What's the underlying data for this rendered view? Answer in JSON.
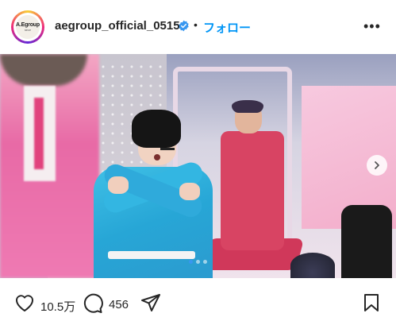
{
  "header": {
    "avatar_logo": "A.Egroup",
    "avatar_sub": "since",
    "username": "aegroup_official_0515",
    "separator": "•",
    "follow_label": "フォロー",
    "more_label": "•••"
  },
  "post": {
    "carousel_dot_count": 3,
    "carousel_active_index": 0
  },
  "actions": {
    "like_count": "10.5万",
    "comment_count": "456"
  },
  "colors": {
    "accent": "#0095f6",
    "text": "#262626",
    "verified": "#3897f0"
  },
  "icons": [
    "verified-badge-icon",
    "more-options-icon",
    "chevron-right-icon",
    "heart-icon",
    "comment-icon",
    "share-icon",
    "bookmark-icon"
  ]
}
